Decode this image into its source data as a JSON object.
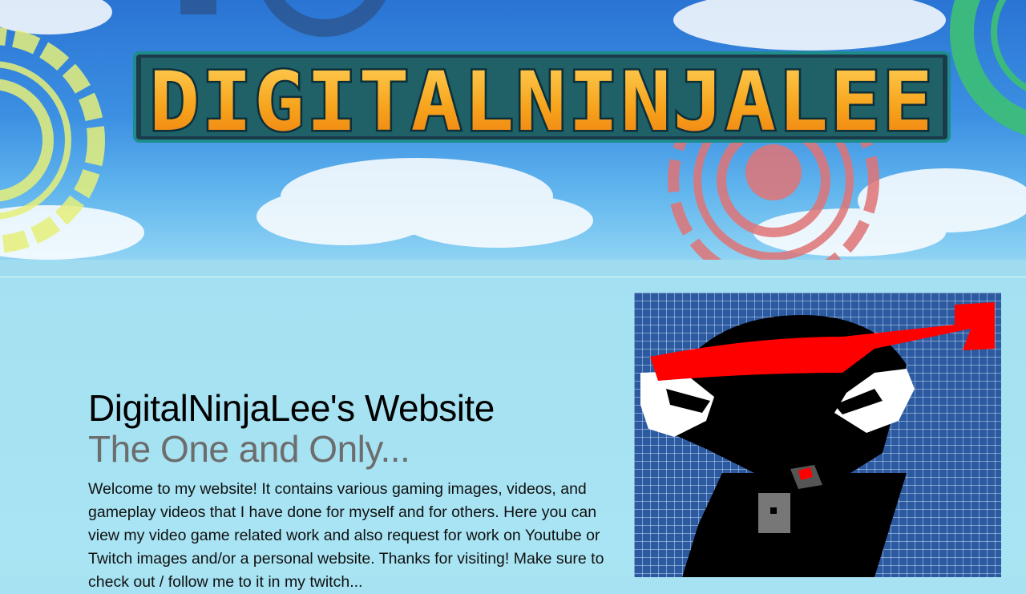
{
  "banner": {
    "logo_text": "DIGITALNINJALEE",
    "sky_color": "#3c90e2",
    "logo_fill": "#f7a41c",
    "logo_outline": "#1f8c8c"
  },
  "hero": {
    "title": "DigitalNinjaLee's Website",
    "subtitle": "The One and Only...",
    "body": "Welcome to my website! It contains various gaming images, videos, and gameplay videos that I have done for myself and for others. Here you can view my video game related work and also request for work on Youtube or Twitch images and/or a personal website. Thanks for visiting! Make sure to check out / follow me to it in my twitch..."
  },
  "avatar": {
    "icon": "ninja-avatar-icon",
    "grid_color": "#2f5fa6",
    "headband_color": "#ff0000"
  }
}
